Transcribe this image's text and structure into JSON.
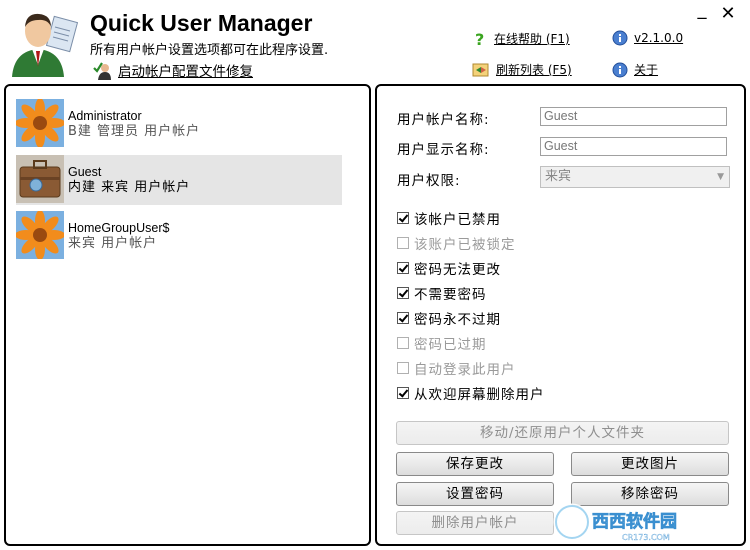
{
  "header": {
    "title": "Quick User Manager",
    "subtitle": "所有用户帐户设置选项都可在此程序设置.",
    "repair_link": "启动帐户配置文件修复",
    "help_link": "在线帮助 (F1)",
    "version_link": "v2.1.0.0",
    "refresh_link": "刷新列表 (F5)",
    "about_link": "关于",
    "minimize": "_",
    "close": "✕"
  },
  "users": [
    {
      "name": "Administrator",
      "desc": "B建 管理员 用户帐户",
      "avatar": "flower-avatar"
    },
    {
      "name": "Guest",
      "desc": "内建 来宾 用户帐户",
      "avatar": "suitcase-avatar"
    },
    {
      "name": "HomeGroupUser$",
      "desc": "来宾 用户帐户",
      "avatar": "flower-avatar"
    }
  ],
  "details": {
    "account_name_label": "用户帐户名称:",
    "account_name_value": "Guest",
    "display_name_label": "用户显示名称:",
    "display_name_value": "Guest",
    "permission_label": "用户权限:",
    "permission_value": "来宾"
  },
  "options": [
    {
      "label": "该帐户已禁用",
      "checked": true,
      "enabled": true
    },
    {
      "label": "该账户已被锁定",
      "checked": false,
      "enabled": false
    },
    {
      "label": "密码无法更改",
      "checked": true,
      "enabled": true
    },
    {
      "label": "不需要密码",
      "checked": true,
      "enabled": true
    },
    {
      "label": "密码永不过期",
      "checked": true,
      "enabled": true
    },
    {
      "label": "密码已过期",
      "checked": false,
      "enabled": false
    },
    {
      "label": "自动登录此用户",
      "checked": false,
      "enabled": false
    },
    {
      "label": "从欢迎屏幕删除用户",
      "checked": true,
      "enabled": true
    }
  ],
  "buttons": {
    "move_restore": "移动/还原用户个人文件夹",
    "save": "保存更改",
    "change_picture": "更改图片",
    "set_password": "设置密码",
    "remove_password": "移除密码",
    "delete_user": "删除用户帐户"
  },
  "watermark": {
    "text": "西西软件园",
    "sub": "CR173.COM"
  },
  "colors": {
    "accent_link": "#000000",
    "selected_row": "#e5e5e5",
    "disabled_text": "#9a9a9a"
  }
}
